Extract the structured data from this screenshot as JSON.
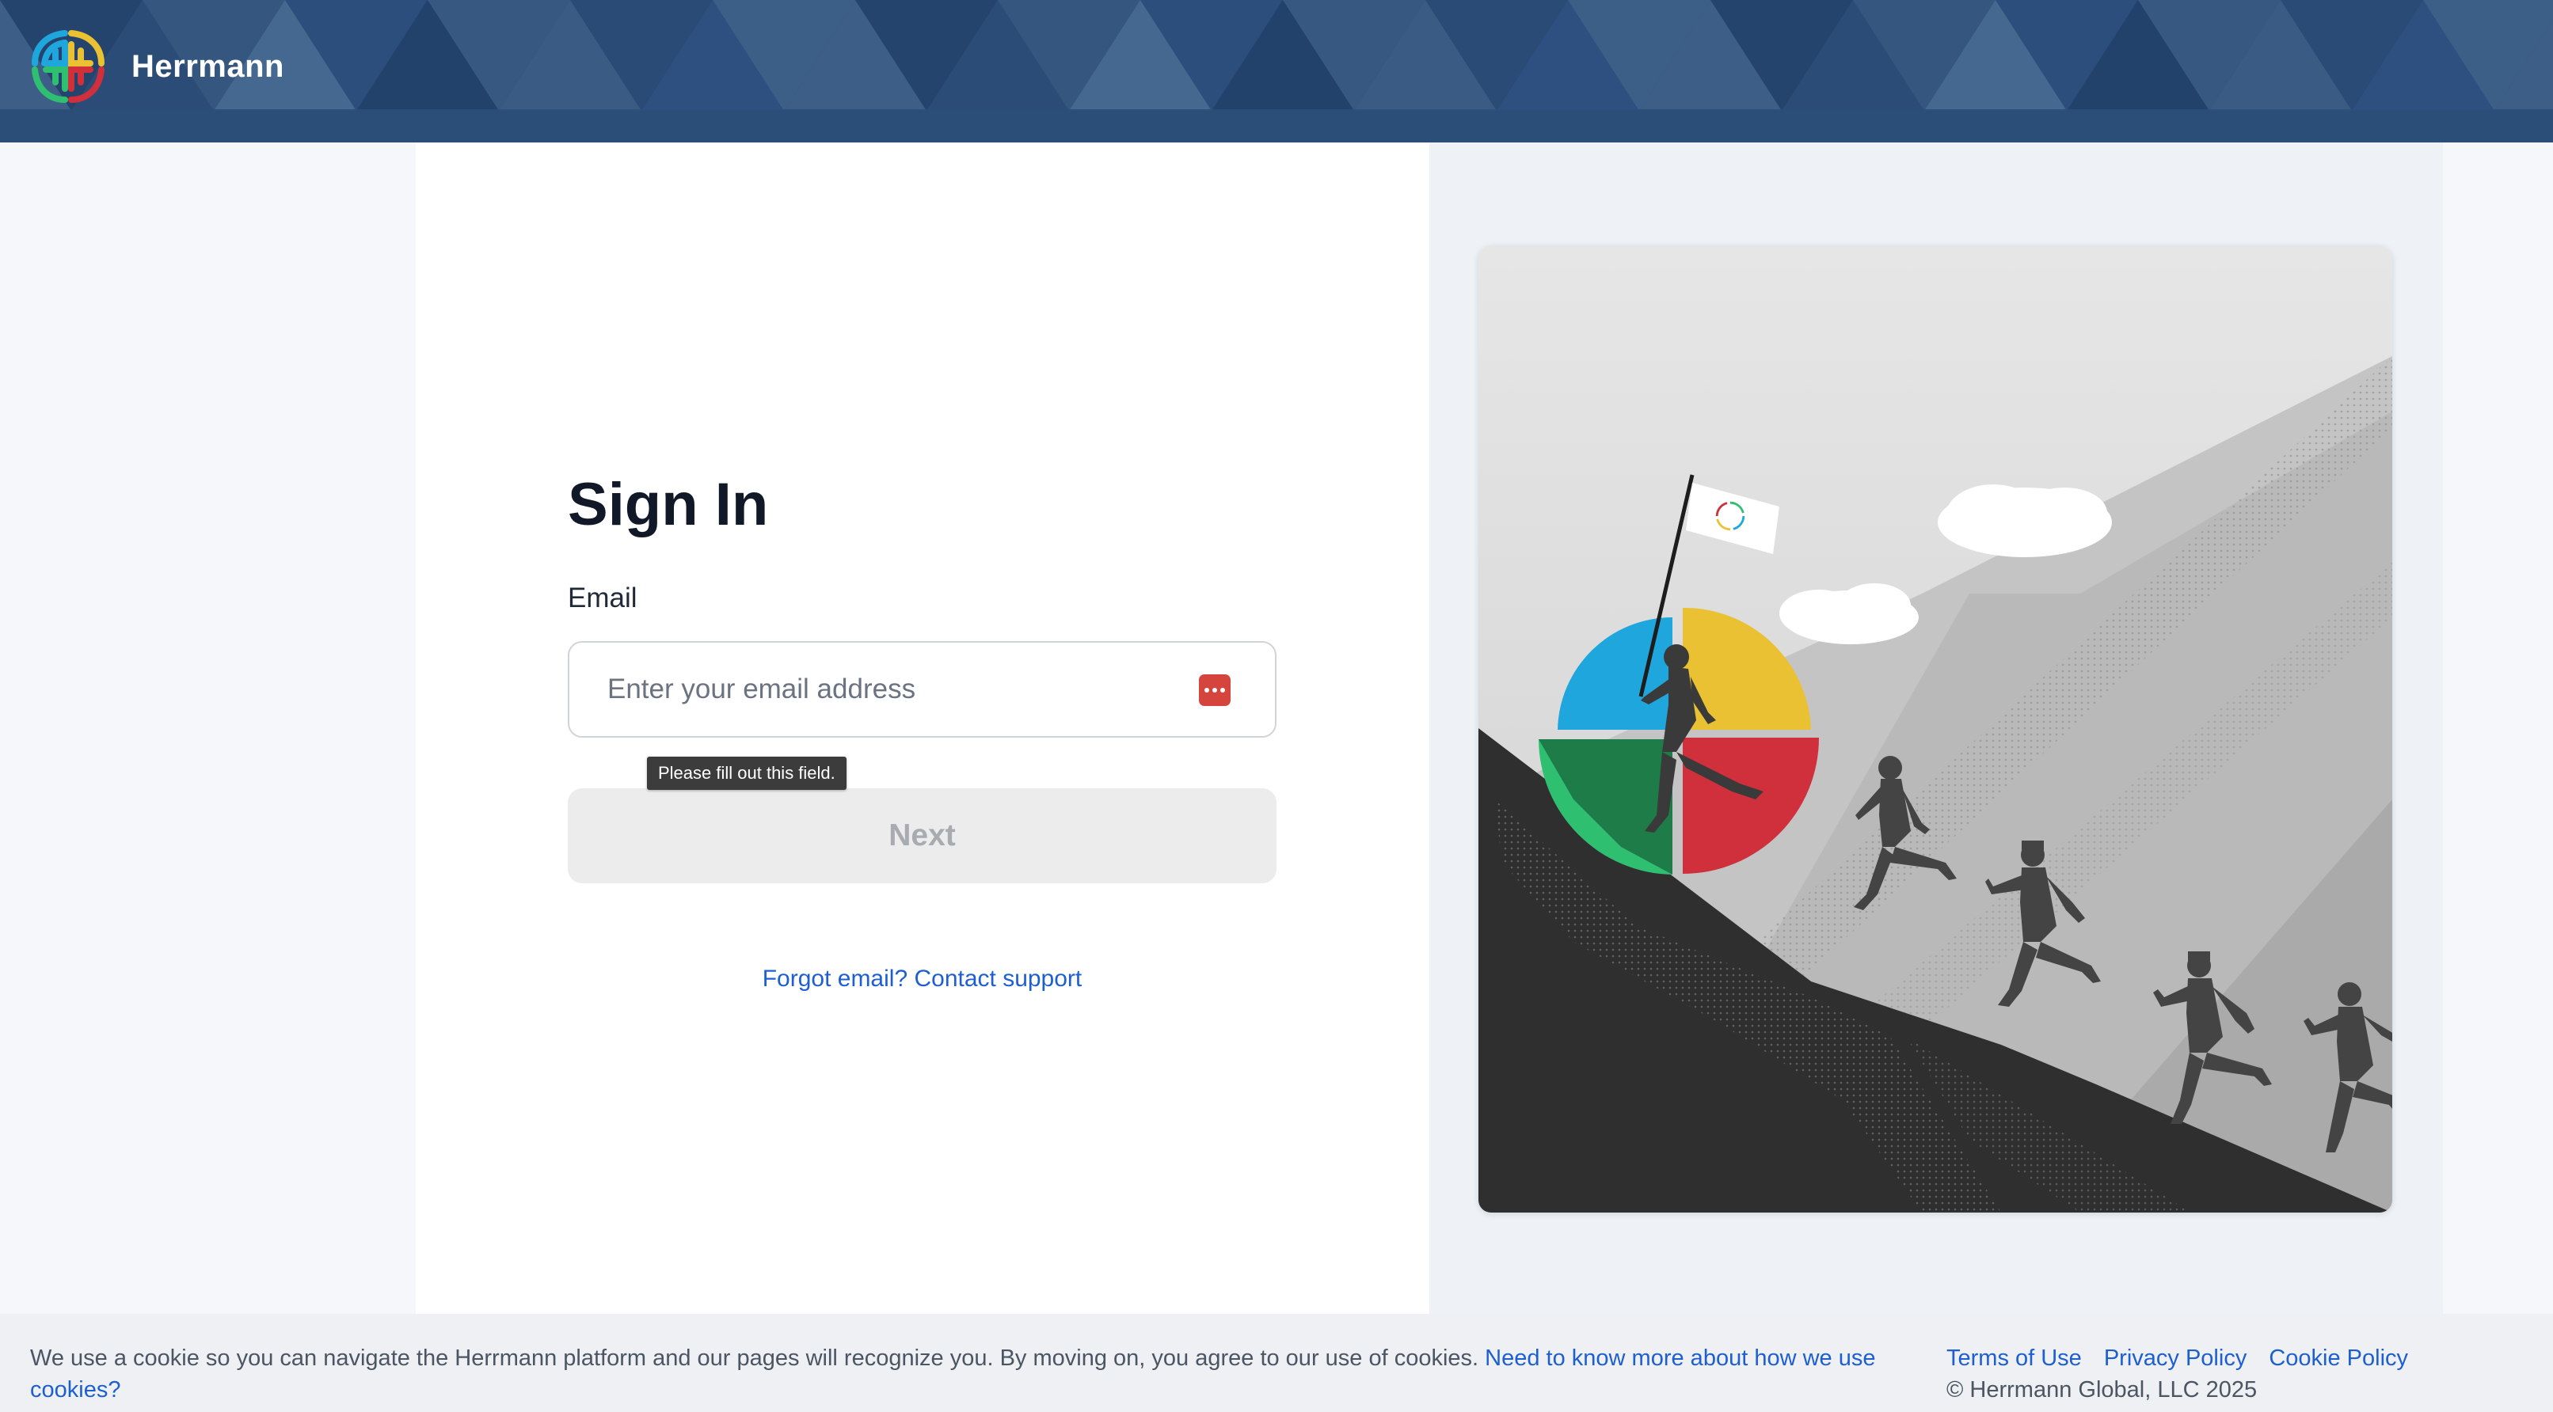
{
  "header": {
    "brand_name": "Herrmann"
  },
  "signin": {
    "title": "Sign In",
    "email_label": "Email",
    "email_placeholder": "Enter your email address",
    "email_value": "",
    "validation_tooltip": "Please fill out this field.",
    "next_label": "Next",
    "support_link": "Forgot email? Contact support"
  },
  "cookie_bar": {
    "message": "We use a cookie so you can navigate the Herrmann platform and our pages will recognize you. By moving on, you agree to our use of cookies.",
    "learn_more_link": "Need to know more about how we use cookies?"
  },
  "footer": {
    "links": [
      "Terms of Use",
      "Privacy Policy",
      "Cookie Policy"
    ],
    "copyright": "© Herrmann Global, LLC 2025"
  },
  "colors": {
    "header_bg": "#294a72",
    "link": "#1d5fd1",
    "brand_blue": "#1fa7dd",
    "brand_yellow": "#e9c132",
    "brand_green": "#2fbf71",
    "brand_red": "#d02f3c"
  },
  "icons": {
    "brand": "herrmann-whole-brain-logo-icon",
    "password_manager": "password-manager-key-icon"
  }
}
